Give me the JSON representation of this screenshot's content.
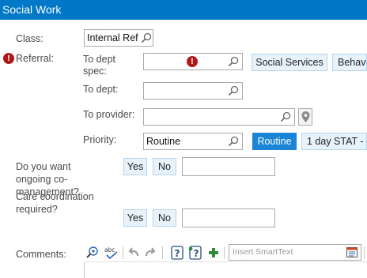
{
  "window": {
    "title": "Social Work"
  },
  "class_field": {
    "label": "Class:",
    "value": "Internal Ref"
  },
  "referral": {
    "label": "Referral:",
    "to_dept_spec_label": "To dept\nspec:",
    "to_dept_label": "To dept:",
    "to_provider_label": "To provider:",
    "priority_label": "Priority:",
    "priority_value": "Routine",
    "spec_buttons": [
      "Social Services",
      "Behavi"
    ],
    "priority_buttons": [
      "Routine",
      "1 day STAT -"
    ]
  },
  "co_management": {
    "label": "Do you want\nongoing co-\nmanagement?",
    "yes": "Yes",
    "no": "No"
  },
  "care_coordination": {
    "label": "Care coordination\nrequired?",
    "yes": "Yes",
    "no": "No"
  },
  "comments": {
    "label": "Comments:",
    "smarttext_placeholder": "Insert SmartText",
    "toolbar_icons": [
      "zoom-icon",
      "spellcheck-icon",
      "undo-icon",
      "redo-icon",
      "help-icon",
      "smartphrase-help-icon",
      "add-icon"
    ]
  },
  "colors": {
    "title_bar": "#0078c8",
    "selected_button": "#1a85d6",
    "option_button": "#e7f2fb",
    "alert": "#b01818",
    "add_icon": "#2e8b3a"
  }
}
